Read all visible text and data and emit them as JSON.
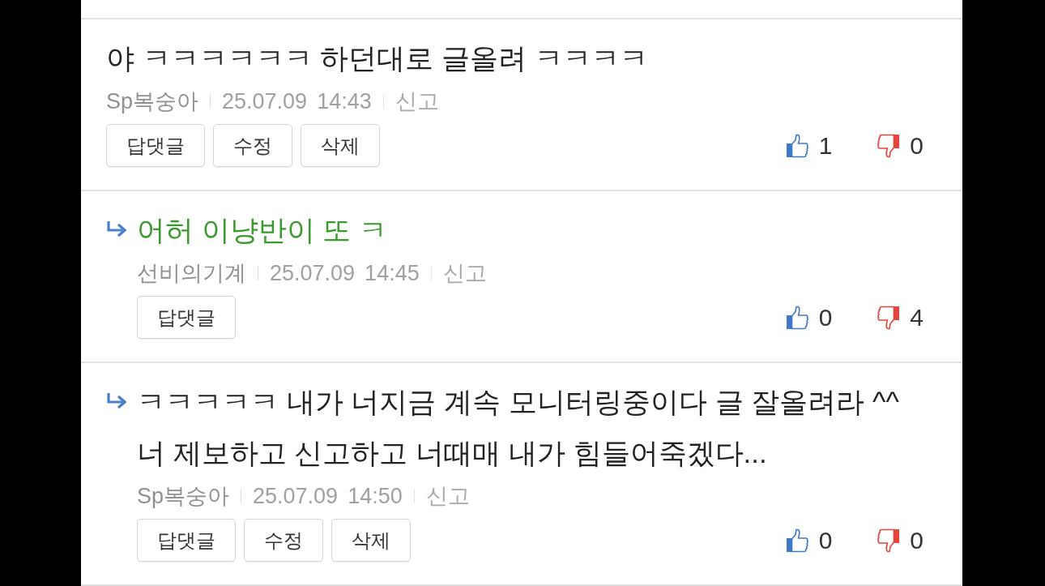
{
  "comments": [
    {
      "kind": "comment",
      "text": "야 ㅋㅋㅋㅋㅋㅋ 하던대로 글올려 ㅋㅋㅋㅋ",
      "color": "#222222",
      "author": "Sp복숭아",
      "date": "25.07.09",
      "time": "14:43",
      "report": "신고",
      "buttons": [
        "답댓글",
        "수정",
        "삭제"
      ],
      "likes": "1",
      "dislikes": "0"
    },
    {
      "kind": "reply",
      "text": "어허 이냥반이 또 ㅋ",
      "color": "#3a9a2e",
      "author": "선비의기계",
      "date": "25.07.09",
      "time": "14:45",
      "report": "신고",
      "buttons": [
        "답댓글"
      ],
      "likes": "0",
      "dislikes": "4"
    },
    {
      "kind": "reply",
      "text": "ㅋㅋㅋㅋㅋ 내가 너지금 계속 모니터링중이다 글 잘올려라 ^^ 너 제보하고 신고하고 너때매 내가 힘들어죽겠다...",
      "color": "#222222",
      "author": "Sp복숭아",
      "date": "25.07.09",
      "time": "14:50",
      "report": "신고",
      "buttons": [
        "답댓글",
        "수정",
        "삭제"
      ],
      "likes": "0",
      "dislikes": "0"
    }
  ]
}
